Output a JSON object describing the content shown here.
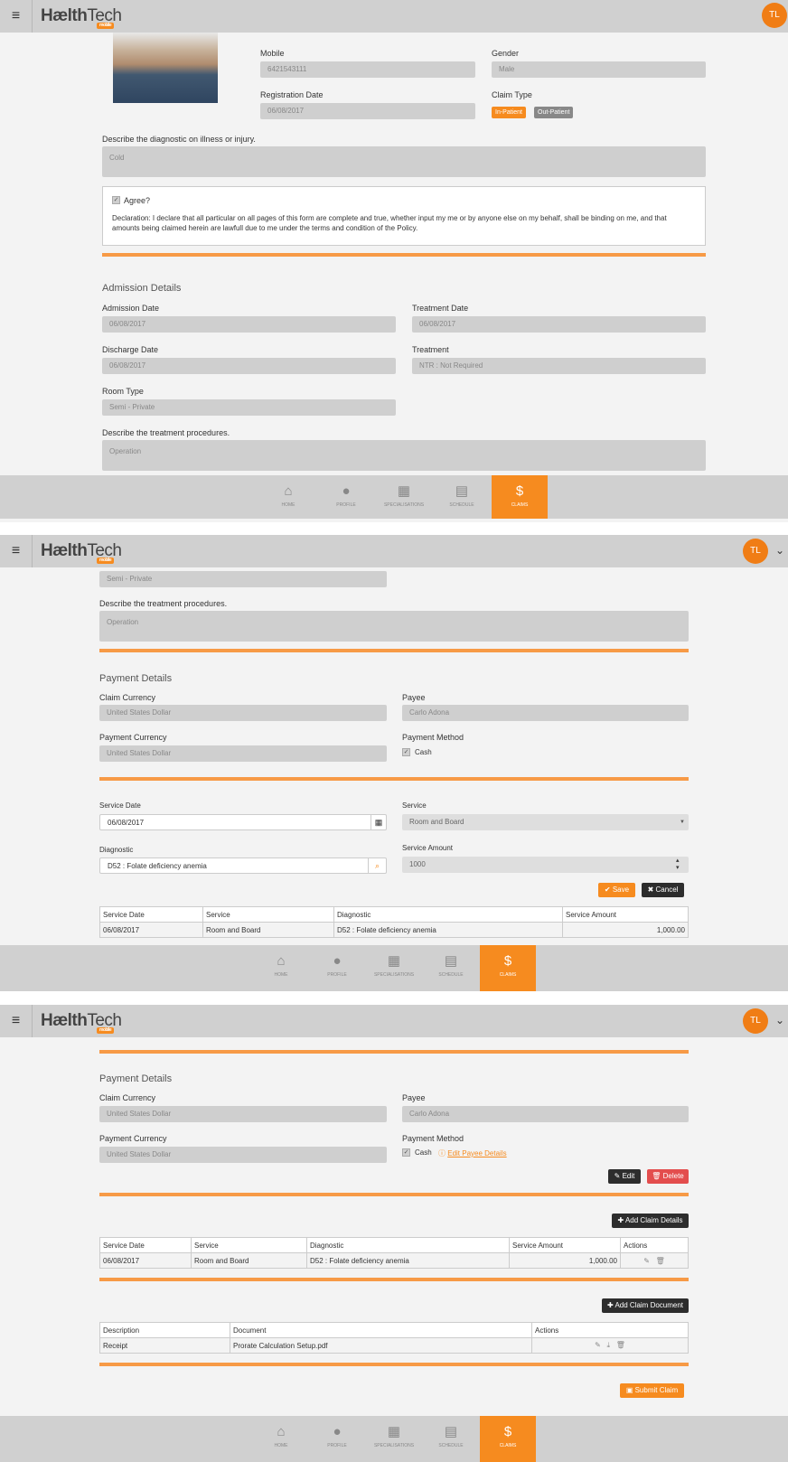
{
  "app": {
    "logo_main": "Hælth",
    "logo_sub": "Tech",
    "logo_badge": "mobile",
    "avatar_initials": "TL",
    "menu_glyph": "≡"
  },
  "colors": {
    "accent": "#f68b1f",
    "header_bg": "#d0d0d0",
    "danger": "#e34d4d",
    "dark_btn": "#2d2d2d"
  },
  "nav": [
    {
      "label": "HOME",
      "icon": "home-icon"
    },
    {
      "label": "PROFILE",
      "icon": "user-icon"
    },
    {
      "label": "SPECIALISATIONS",
      "icon": "specialisations-icon"
    },
    {
      "label": "SCHEDULE",
      "icon": "calendar-icon"
    },
    {
      "label": "CLAIMS",
      "icon": "dollar-icon"
    }
  ],
  "s1": {
    "mobile_label": "Mobile",
    "mobile": "6421543111",
    "gender_label": "Gender",
    "gender": "Male",
    "reg_label": "Registration Date",
    "reg": "06/08/2017",
    "claim_type_label": "Claim Type",
    "inpatient": "In-Patient",
    "outpatient": "Out-Patient",
    "diag_label": "Describe the diagnostic on illness or injury.",
    "diag": "Cold",
    "agree": "Agree?",
    "declaration": "Declaration: I declare that all particular on all pages of this form are complete and true, whether input my me or by anyone else on my behalf, shall be binding on me, and that amounts being claimed herein are lawfull due to me under the terms and condition of the Policy.",
    "admission_title": "Admission Details",
    "adm_date_label": "Admission Date",
    "adm_date": "06/08/2017",
    "treat_date_label": "Treatment Date",
    "treat_date": "06/08/2017",
    "dis_date_label": "Discharge Date",
    "dis_date": "06/08/2017",
    "treatment_label": "Treatment",
    "treatment": "NTR : Not Required",
    "room_label": "Room Type",
    "room": "Semi - Private",
    "proc_label": "Describe the treatment procedures.",
    "proc": "Operation"
  },
  "s2": {
    "room": "Semi - Private",
    "proc_label": "Describe the treatment procedures.",
    "proc": "Operation",
    "payment_title": "Payment Details",
    "claim_cur_label": "Claim Currency",
    "claim_cur": "United States Dollar",
    "payee_label": "Payee",
    "payee": "Carlo Adona",
    "pay_cur_label": "Payment Currency",
    "pay_cur": "United States Dollar",
    "pay_method_label": "Payment Method",
    "cash": "Cash",
    "service_date_label": "Service Date",
    "service_date": "06/08/2017",
    "service_label": "Service",
    "service": "Room and Board",
    "diagnostic_label": "Diagnostic",
    "diagnostic": "D52 : Folate deficiency anemia",
    "amount_label": "Service Amount",
    "amount": "1000",
    "save": "Save",
    "cancel": "Cancel",
    "table_headers": [
      "Service Date",
      "Service",
      "Diagnostic",
      "Service Amount"
    ],
    "table_row": [
      "06/08/2017",
      "Room and Board",
      "D52 : Folate deficiency anemia",
      "1,000.00"
    ]
  },
  "s3": {
    "payment_title": "Payment Details",
    "claim_cur_label": "Claim Currency",
    "claim_cur": "United States Dollar",
    "payee_label": "Payee",
    "payee": "Carlo Adona",
    "pay_cur_label": "Payment Currency",
    "pay_cur": "United States Dollar",
    "pay_method_label": "Payment Method",
    "cash": "Cash",
    "edit_payee": "Edit Payee Details",
    "edit": "Edit",
    "delete": "Delete",
    "add_claim_details": "Add Claim Details",
    "details_headers": [
      "Service Date",
      "Service",
      "Diagnostic",
      "Service Amount",
      "Actions"
    ],
    "details_row": [
      "06/08/2017",
      "Room and Board",
      "D52 : Folate deficiency anemia",
      "1,000.00"
    ],
    "add_claim_document": "Add Claim Document",
    "doc_headers": [
      "Description",
      "Document",
      "Actions"
    ],
    "doc_row": [
      "Receipt",
      "Prorate Calculation Setup.pdf"
    ],
    "submit": "Submit Claim"
  }
}
